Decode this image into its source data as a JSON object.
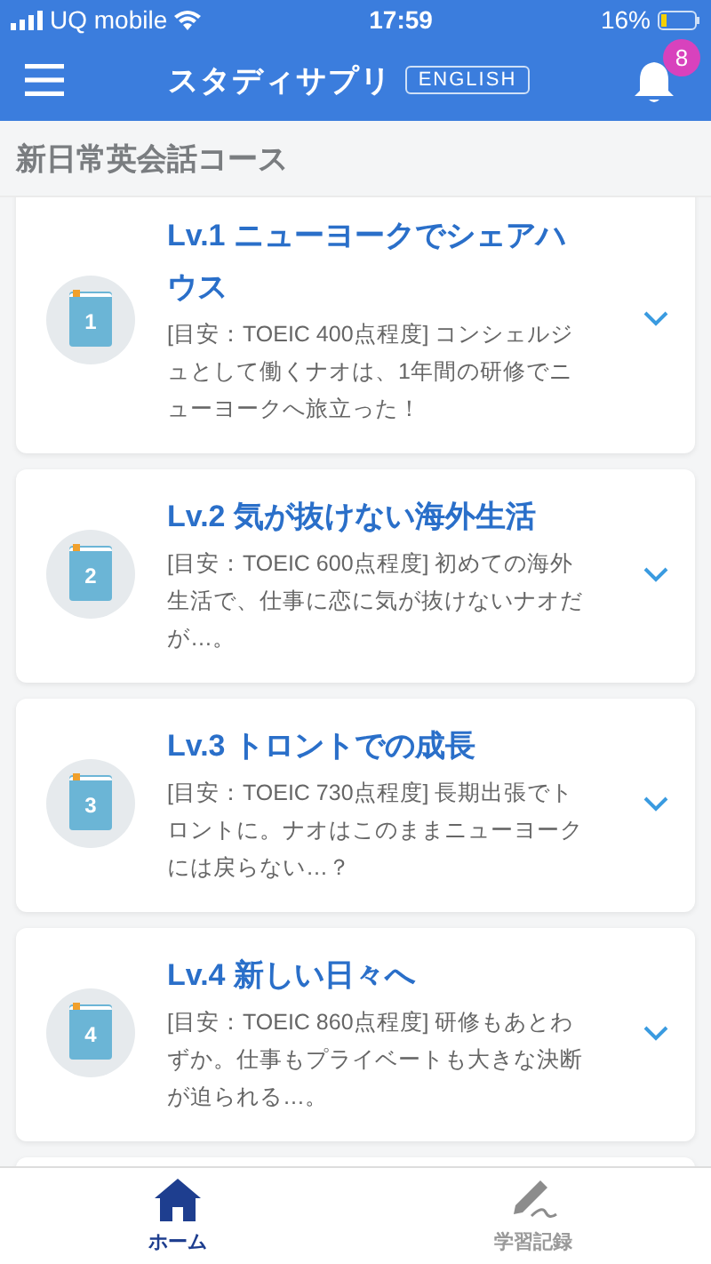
{
  "status_bar": {
    "carrier": "UQ mobile",
    "time": "17:59",
    "battery": "16%"
  },
  "header": {
    "logo": "スタディサプリ",
    "logo_tag": "ENGLISH",
    "notification_count": "8"
  },
  "section_title": "新日常英会話コース",
  "courses": [
    {
      "title": "Lv.1 ニューヨークでシェアハウス",
      "number": "1",
      "description": "[目安：TOEIC 400点程度] コンシェルジュとして働くナオは、1年間の研修でニューヨークへ旅立った！"
    },
    {
      "title": "Lv.2 気が抜けない海外生活",
      "number": "2",
      "description": "[目安：TOEIC 600点程度] 初めての海外生活で、仕事に恋に気が抜けないナオだが…。"
    },
    {
      "title": "Lv.3 トロントでの成長",
      "number": "3",
      "description": "[目安：TOEIC 730点程度] 長期出張でトロントに。ナオはこのままニューヨークには戻らない…？"
    },
    {
      "title": "Lv.4 新しい日々へ",
      "number": "4",
      "description": "[目安：TOEIC 860点程度] 研修もあとわずか。仕事もプライベートも大きな決断が迫られる…。"
    }
  ],
  "tabs": [
    {
      "label": "ホーム",
      "kind": "home",
      "selected": true
    },
    {
      "label": "学習記録",
      "kind": "record",
      "selected": false
    }
  ]
}
